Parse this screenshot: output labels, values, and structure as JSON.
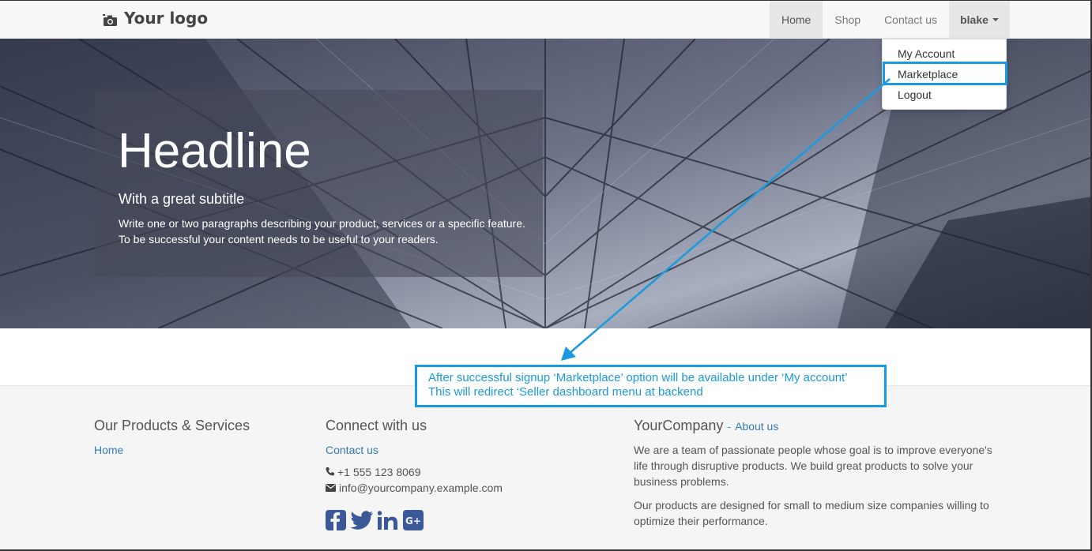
{
  "navbar": {
    "logo_text": "Your logo",
    "items": [
      {
        "label": "Home"
      },
      {
        "label": "Shop"
      },
      {
        "label": "Contact us"
      }
    ],
    "user_label": "blake"
  },
  "dropdown": {
    "items": [
      {
        "label": "My Account"
      },
      {
        "label": "Marketplace"
      },
      {
        "label": "Logout"
      }
    ]
  },
  "hero": {
    "headline": "Headline",
    "subtitle": "With a great subtitle",
    "paragraph_line1": "Write one or two paragraphs describing your product, services or a specific feature.",
    "paragraph_line2": "To be successful your content needs to be useful to your readers."
  },
  "annotation": {
    "line1": "After successful signup ‘Marketplace’ option will be available under ‘My account’",
    "line2": "This will redirect ‘Seller dashboard menu at backend",
    "color": "#1a9ae0"
  },
  "footer": {
    "products": {
      "heading": "Our Products & Services",
      "link": "Home"
    },
    "connect": {
      "heading": "Connect with us",
      "link": "Contact us",
      "phone": "+1 555 123 8069",
      "email": "info@yourcompany.example.com",
      "social_icons": [
        "facebook-icon",
        "twitter-icon",
        "linkedin-icon",
        "google-plus-icon"
      ]
    },
    "company": {
      "heading": "YourCompany",
      "separator": "-",
      "link": "About us",
      "para1_line1": "We are a team of passionate people whose goal is to improve everyone's",
      "para1_line2": "life through disruptive products. We build great products to solve your",
      "para1_line3": "business problems.",
      "para2_line1": "Our products are designed for small to medium size companies willing to",
      "para2_line2": "optimize their performance."
    }
  },
  "colors": {
    "link": "#337ab7",
    "accent": "#1a9ae0",
    "social": "#3b5998"
  }
}
